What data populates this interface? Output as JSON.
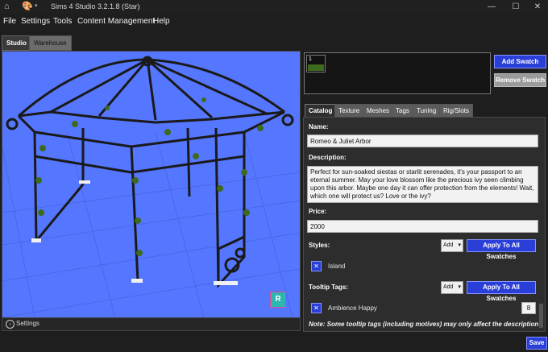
{
  "window": {
    "title": "Sims 4 Studio 3.2.1.8 (Star)",
    "minimize": "—",
    "maximize": "☐",
    "close": "✕"
  },
  "menu": [
    "File",
    "Settings",
    "Tools",
    "Content Management",
    "Help"
  ],
  "tabs": {
    "studio": "Studio",
    "warehouse": "Warehouse"
  },
  "viewport": {
    "settings_label": "Settings",
    "gizmo_letter": "R"
  },
  "swatches": {
    "items": [
      {
        "label": "1",
        "color": "#3d6a1d"
      }
    ],
    "add_label": "Add Swatch",
    "remove_label": "Remove Swatch"
  },
  "content_tabs": [
    "Catalog",
    "Texture",
    "Meshes",
    "Tags",
    "Tuning",
    "Rig/Slots"
  ],
  "catalog": {
    "name_label": "Name:",
    "name_value": "Romeo & Juliet Arbor",
    "description_label": "Description:",
    "description_value": "Perfect for sun-soaked siestas or starlit serenades, it's your passport to an eternal summer. May your love blossom like the precious ivy seen climbing upon this arbor. Maybe one day it can offer protection from the elements! Wait, which one will protect us? Love or the ivy?",
    "price_label": "Price:",
    "price_value": "2000",
    "styles_label": "Styles:",
    "add_select": "Add",
    "apply_all_label": "Apply To All Swatches",
    "styles": [
      "Island"
    ],
    "tooltip_label": "Tooltip Tags:",
    "tooltip_tags": [
      {
        "name": "Ambience Happy",
        "value": "8"
      }
    ],
    "note": "Note: Some tooltip tags (including motives) may only affect the description"
  },
  "save_label": "Save",
  "colors": {
    "viewport_bg": "#5577ff",
    "accent_button": "#2a3fd8",
    "app_bg": "#1e1e1e"
  }
}
